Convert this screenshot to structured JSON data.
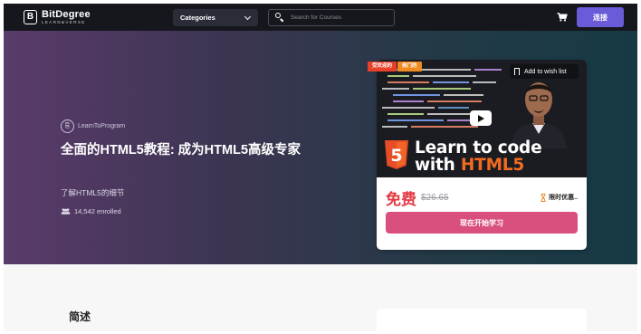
{
  "nav": {
    "logo_letter": "B",
    "brand_name": "BitDegree",
    "brand_sub": "LEARN&VERSE",
    "categories_label": "Categories",
    "search_placeholder": "Search for Courses",
    "login_label": "连接"
  },
  "badges": [
    "受欢迎的",
    "热门的"
  ],
  "course": {
    "provider": "LearnToProgram",
    "title": "全面的HTML5教程: 成为HTML5高级专家",
    "subtitle": "了解HTML5的细节",
    "enrolled": "14,542 enrolled",
    "wishlist_label": "Add to wish list",
    "thumb_line1": "Learn to code",
    "thumb_line2_a": "with ",
    "thumb_line2_b": "HTML5",
    "shield_number": "5",
    "price": "免费",
    "original_price": "$26.65",
    "timer_label": "限时优惠..",
    "cta_label": "现在开始学习"
  },
  "sections": {
    "intro_heading": "简述"
  },
  "colors": {
    "accent_purple": "#6a5bd9",
    "cta_pink": "#d94f7e",
    "price_red": "#e43a44",
    "html5_orange": "#f26b21"
  }
}
